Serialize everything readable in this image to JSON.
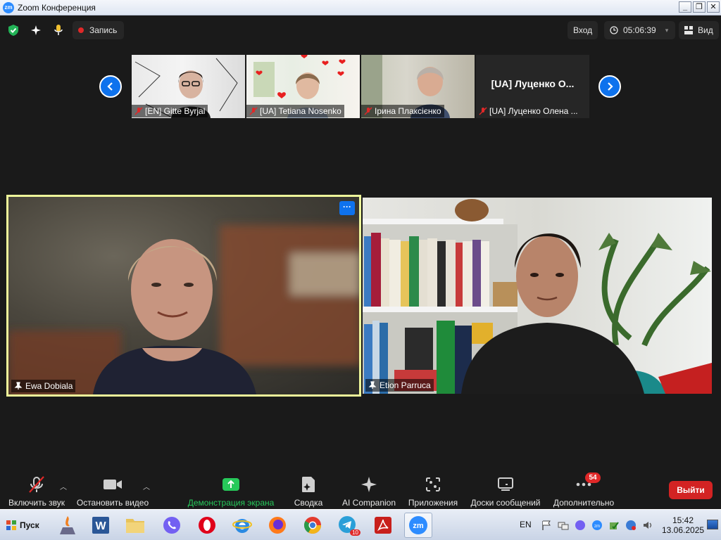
{
  "window": {
    "title": "Zoom Конференция",
    "app_icon": "zm"
  },
  "topbar": {
    "record_label": "Запись",
    "signin_label": "Вход",
    "timer": "05:06:39",
    "view_label": "Вид"
  },
  "thumbnails": [
    {
      "name": "[EN] Gitte Byrjal",
      "muted": true
    },
    {
      "name": "[UA] Tetiana Nosenko",
      "muted": true
    },
    {
      "name": "Ірина Плаксієнко",
      "muted": true
    },
    {
      "name": "[UA] Луценко Олена ...",
      "muted": true,
      "display_name": "[UA]  Луценко О..."
    }
  ],
  "tiles": [
    {
      "name": "Ewa Dobiala",
      "active_speaker": true
    },
    {
      "name": "Etion Parruca",
      "active_speaker": false
    }
  ],
  "toolbar": {
    "unmute_label": "Включить звук",
    "stop_video_label": "Остановить видео",
    "share_label": "Демонстрация экрана",
    "summary_label": "Сводка",
    "ai_label": "AI Companion",
    "apps_label": "Приложения",
    "docs_label": "Доски сообщений",
    "more_label": "Дополнительно",
    "more_badge": "54",
    "leave_label": "Выйти"
  },
  "taskbar": {
    "start_label": "Пуск",
    "lang": "EN",
    "time": "15:42",
    "date": "13.06.2025",
    "telegram_badge": "10"
  },
  "colors": {
    "accent": "#0e72ed",
    "share_green": "#27c95a",
    "leave_red": "#d32323",
    "speaker_border": "#eef79a"
  }
}
